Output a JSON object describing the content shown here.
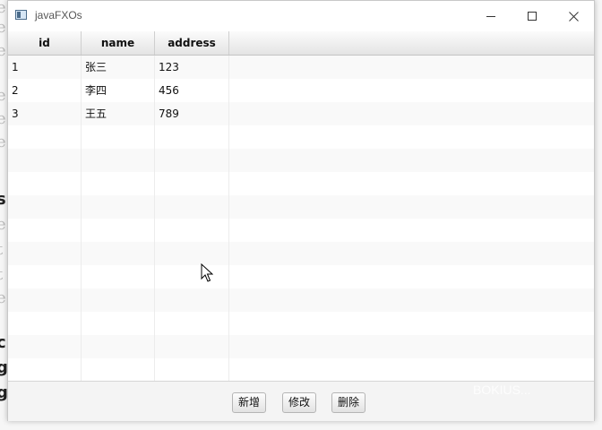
{
  "window": {
    "title": "javaFXOs"
  },
  "table": {
    "columns": [
      "id",
      "name",
      "address"
    ],
    "rows": [
      [
        "1",
        "张三",
        "123"
      ],
      [
        "2",
        "李四",
        "456"
      ],
      [
        "3",
        "王五",
        "789"
      ]
    ]
  },
  "actions": {
    "add_label": "新增",
    "edit_label": "修改",
    "delete_label": "删除"
  },
  "icons": {
    "app": "javafx-window-icon",
    "minimize": "minimize-icon",
    "maximize": "maximize-icon",
    "close": "close-icon",
    "cursor": "mouse-pointer-icon"
  },
  "watermark": "BOKIUS..."
}
